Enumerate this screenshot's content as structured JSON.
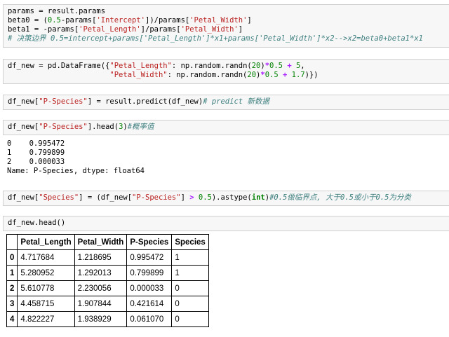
{
  "cells": {
    "c1": {
      "l1": "params = result.params",
      "l2a": "beta0 = (",
      "l2b": "0.5",
      "l2c": "-params[",
      "l2d": "'Intercept'",
      "l2e": "])/params[",
      "l2f": "'Petal_Width'",
      "l2g": "]",
      "l3a": "beta1 = -params[",
      "l3b": "'Petal_Length'",
      "l3c": "]/params[",
      "l3d": "'Petal_Width'",
      "l3e": "]",
      "l4": "# 决策边界 0.5=intercept+params['Petal_Length']*x1+params['Petal_Width']*x2-->x2=beta0+beta1*x1"
    },
    "c2": {
      "l1a": "df_new = pd.DataFrame({",
      "l1b": "\"Petal_Length\"",
      "l1c": ": np.random.randn(",
      "l1d": "20",
      "l1e": ")",
      "l1f": "*",
      "l1g": "0.5",
      "l1h": " + ",
      "l1i": "5",
      "l1j": ",",
      "l2pad": "                       ",
      "l2a": "\"Petal_Width\"",
      "l2b": ": np.random.randn(",
      "l2c": "20",
      "l2d": ")",
      "l2e": "*",
      "l2f": "0.5",
      "l2g": " + ",
      "l2h": "1.7",
      "l2i": ")})"
    },
    "c3": {
      "a": "df_new[",
      "b": "\"P-Species\"",
      "c": "] = result.predict(df_new)",
      "d": "# predict 新数据"
    },
    "c4": {
      "a": "df_new[",
      "b": "\"P-Species\"",
      "c": "].head(",
      "d": "3",
      "e": ")",
      "f": "#概率值"
    },
    "c4_out": [
      "0    0.995472",
      "1    0.799899",
      "2    0.000033",
      "Name: P-Species, dtype: float64"
    ],
    "c5": {
      "a": "df_new[",
      "b": "\"Species\"",
      "c": "] = (df_new[",
      "d": "\"P-Species\"",
      "e": "] ",
      "f": ">",
      "g": " ",
      "h": "0.5",
      "i": ").astype(",
      "j": "int",
      "k": ")",
      "l": "#0.5做临界点, 大于0.5或小于0.5为分类"
    },
    "c6": {
      "a": "df_new.head()"
    }
  },
  "table": {
    "headers": [
      "",
      "Petal_Length",
      "Petal_Width",
      "P-Species",
      "Species"
    ],
    "rows": [
      [
        "0",
        "4.717684",
        "1.218695",
        "0.995472",
        "1"
      ],
      [
        "1",
        "5.280952",
        "1.292013",
        "0.799899",
        "1"
      ],
      [
        "2",
        "5.610778",
        "2.230056",
        "0.000033",
        "0"
      ],
      [
        "3",
        "4.458715",
        "1.907844",
        "0.421614",
        "0"
      ],
      [
        "4",
        "4.822227",
        "1.938929",
        "0.061070",
        "0"
      ]
    ]
  }
}
